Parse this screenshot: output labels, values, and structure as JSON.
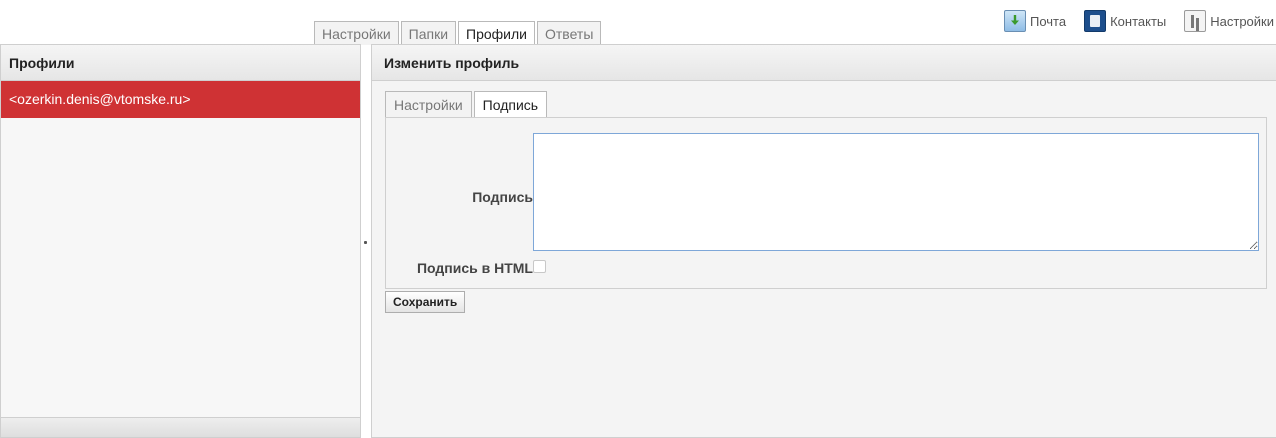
{
  "taskbar": {
    "mail": {
      "label": "Почта",
      "icon": "mail-icon"
    },
    "contacts": {
      "label": "Контакты",
      "icon": "contacts-icon"
    },
    "settings": {
      "label": "Настройки",
      "icon": "settings-icon"
    }
  },
  "main_tabs": [
    {
      "label": "Настройки",
      "active": false
    },
    {
      "label": "Папки",
      "active": false
    },
    {
      "label": "Профили",
      "active": true
    },
    {
      "label": "Ответы",
      "active": false
    }
  ],
  "profiles_panel": {
    "title": "Профили",
    "items": [
      {
        "label": "<ozerkin.denis@vtomske.ru>",
        "selected": true
      }
    ]
  },
  "edit_panel": {
    "title": "Изменить профиль",
    "tabs": [
      {
        "label": "Настройки",
        "active": false
      },
      {
        "label": "Подпись",
        "active": true
      }
    ],
    "signature_label": "Подпись",
    "signature_value": "",
    "html_signature_label": "Подпись в HTML",
    "html_signature_checked": false,
    "save_label": "Сохранить"
  },
  "colors": {
    "selected_row": "#cf3234",
    "textarea_border": "#7ea7d8"
  }
}
